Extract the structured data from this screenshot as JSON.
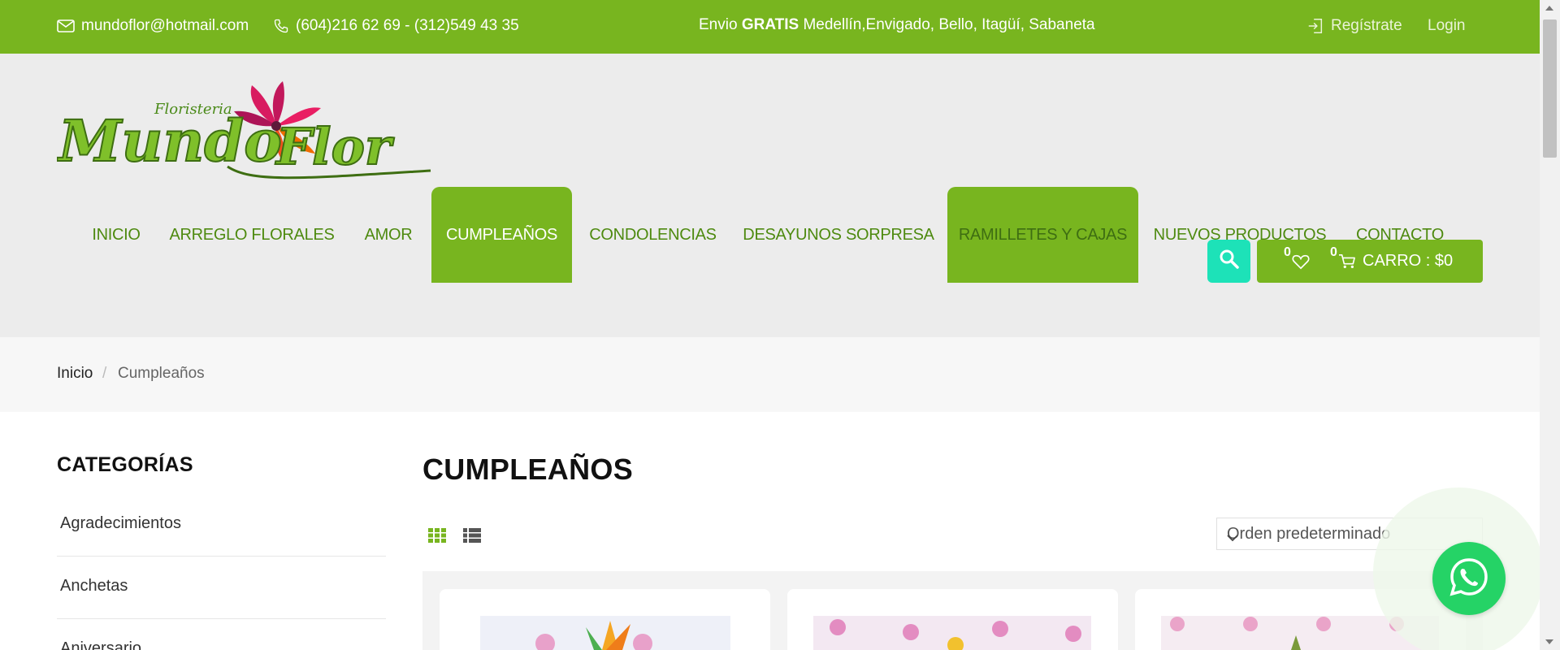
{
  "topbar": {
    "email": "mundoflor@hotmail.com",
    "phone": "(604)216 62 69 - (312)549 43 35",
    "promo_prefix": "Envio ",
    "promo_bold": "GRATIS",
    "promo_suffix": " Medellín,Envigado, Bello, Itagüí, Sabaneta",
    "register": "Regístrate",
    "login": "Login",
    "bg_color": "#78b51f"
  },
  "logo": {
    "small_text": "Floristeria",
    "main_text": "MundoFlor"
  },
  "nav": {
    "items": [
      {
        "label": "INICIO"
      },
      {
        "label": "ARREGLO FLORALES"
      },
      {
        "label": "AMOR"
      },
      {
        "label": "CUMPLEAÑOS"
      },
      {
        "label": "CONDOLENCIAS"
      },
      {
        "label": "DESAYUNOS SORPRESA"
      },
      {
        "label": "RAMILLETES Y CAJAS"
      },
      {
        "label": "NUEVOS PRODUCTOS"
      },
      {
        "label": "CONTACTO"
      }
    ],
    "active_color": "#78b51f",
    "text_color": "#4e8a10"
  },
  "cart": {
    "wishlist_count": "0",
    "cart_count": "0",
    "label": "CARRO : $0"
  },
  "breadcrumb": {
    "home": "Inicio",
    "separator": "/",
    "current": "Cumpleaños"
  },
  "sidebar": {
    "title": "CATEGORÍAS",
    "categories": [
      {
        "label": "Agradecimientos"
      },
      {
        "label": "Anchetas"
      },
      {
        "label": "Aniversario"
      }
    ]
  },
  "main": {
    "title": "CUMPLEAÑOS",
    "sort_value": "Orden predeterminado"
  },
  "icons": {
    "email": "envelope-icon",
    "phone": "phone-icon",
    "register": "login-door-icon",
    "search": "search-icon",
    "wishlist": "heart-icon",
    "cart": "cart-icon",
    "grid_view": "grid-icon",
    "list_view": "list-icon",
    "whatsapp": "whatsapp-icon"
  },
  "colors": {
    "brand_green": "#78b51f",
    "search_teal": "#1de2b8",
    "whatsapp": "#25d366"
  }
}
